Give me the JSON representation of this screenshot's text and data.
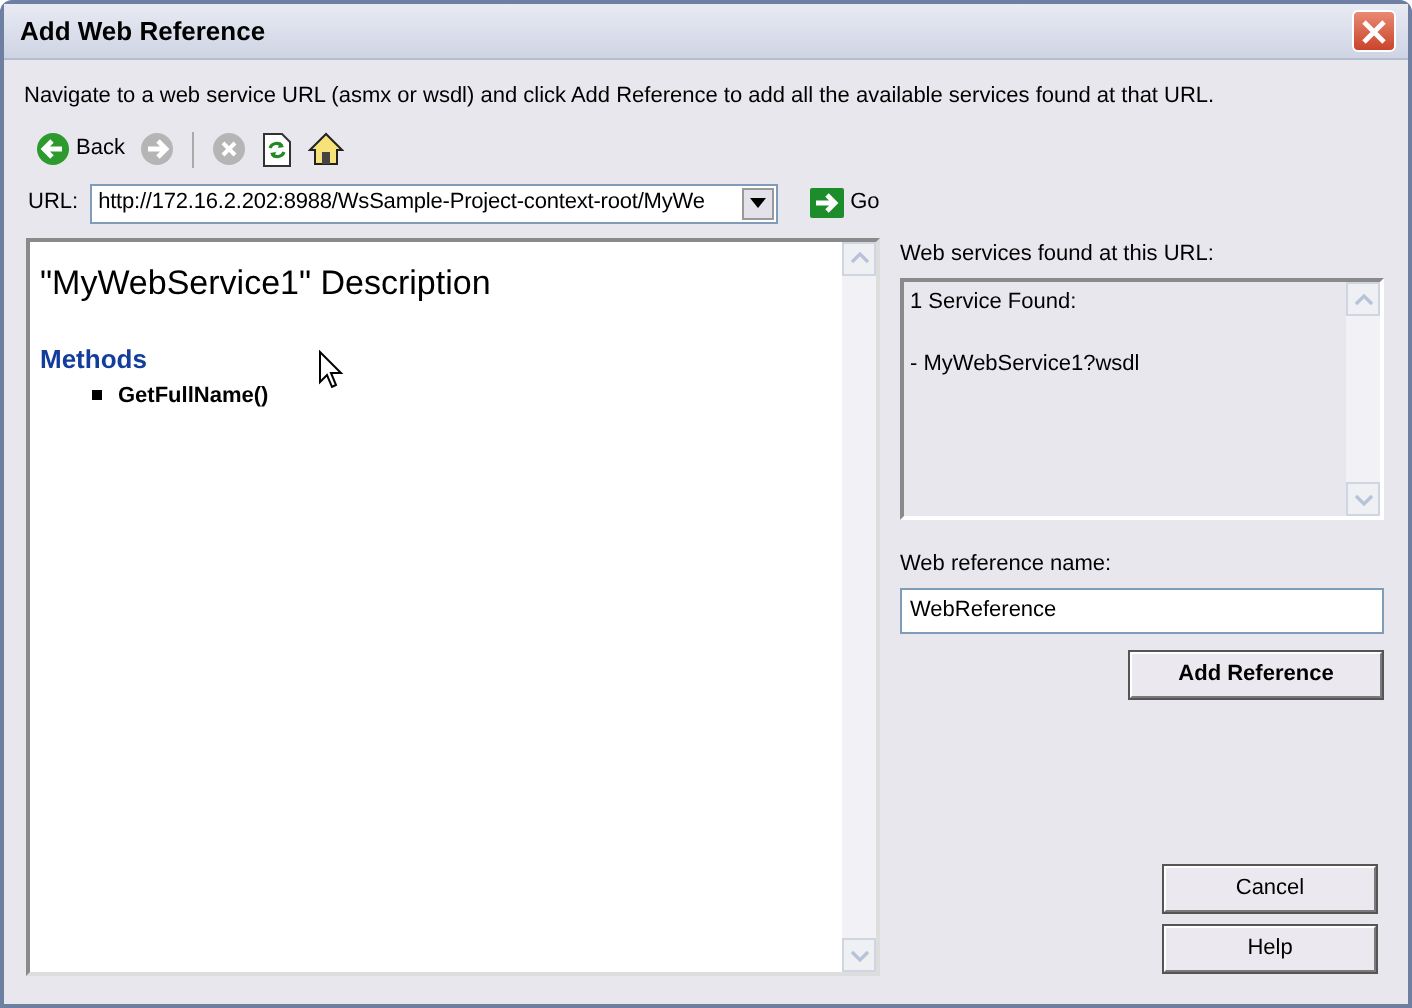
{
  "window": {
    "title": "Add Web Reference"
  },
  "instructions": "Navigate to a web service URL (asmx or wsdl) and click Add Reference to add all the available services found at that URL.",
  "toolbar": [
    {
      "kind": "back",
      "label": "Back",
      "disabled": false
    },
    {
      "kind": "forward",
      "disabled": true
    },
    {
      "kind": "stop",
      "disabled": true
    },
    {
      "kind": "refresh",
      "disabled": false
    },
    {
      "kind": "home",
      "disabled": false
    }
  ],
  "url": {
    "label": "URL:",
    "value": "http://172.16.2.202:8988/WsSample-Project-context-root/MyWe"
  },
  "go_button": "Go",
  "browser": {
    "heading": "\"MyWebService1\" Description",
    "section": "Methods",
    "methods": [
      "GetFullName()"
    ]
  },
  "services": {
    "label": "Web services found at this URL:",
    "lines": [
      "1 Service Found:",
      "- MyWebService1?wsdl"
    ]
  },
  "reference_name": {
    "label": "Web reference name:",
    "value": "WebReference"
  },
  "buttons": [
    {
      "label": "Add Reference",
      "kind": "add"
    },
    {
      "label": "Cancel",
      "kind": "plain"
    },
    {
      "label": "Help",
      "kind": "plain"
    }
  ]
}
